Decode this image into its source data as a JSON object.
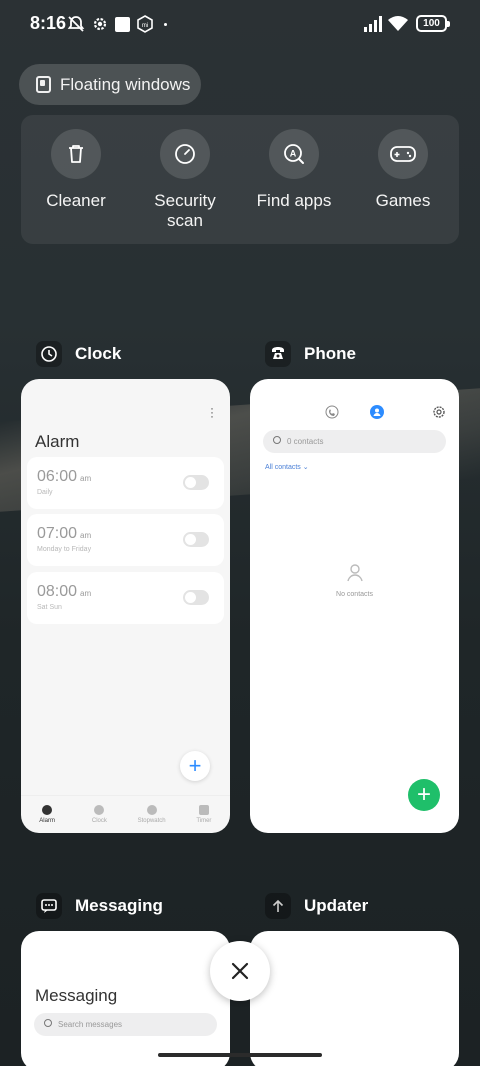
{
  "status_bar": {
    "time": "8:16",
    "battery": "100"
  },
  "floating_windows": {
    "label": "Floating windows"
  },
  "quick_actions": [
    {
      "label": "Cleaner",
      "icon": "trash-icon"
    },
    {
      "label": "Security scan",
      "icon": "security-scan-icon"
    },
    {
      "label": "Find apps",
      "icon": "find-apps-icon"
    },
    {
      "label": "Games",
      "icon": "gamepad-icon"
    }
  ],
  "apps": {
    "clock": {
      "name": "Clock",
      "title": "Alarm",
      "alarms": [
        {
          "time": "06:00",
          "ampm": "am",
          "repeat": "Daily"
        },
        {
          "time": "07:00",
          "ampm": "am",
          "repeat": "Monday to Friday"
        },
        {
          "time": "08:00",
          "ampm": "am",
          "repeat": "Sat Sun"
        }
      ],
      "nav": [
        "Alarm",
        "Clock",
        "Stopwatch",
        "Timer"
      ]
    },
    "phone": {
      "name": "Phone",
      "search_placeholder": "0 contacts",
      "filter": "All contacts",
      "empty_text": "No contacts"
    },
    "messaging": {
      "name": "Messaging",
      "title": "Messaging",
      "search_placeholder": "Search messages"
    },
    "updater": {
      "name": "Updater"
    }
  },
  "colors": {
    "accent_blue": "#2d8cff",
    "accent_green": "#1fbf6a"
  }
}
